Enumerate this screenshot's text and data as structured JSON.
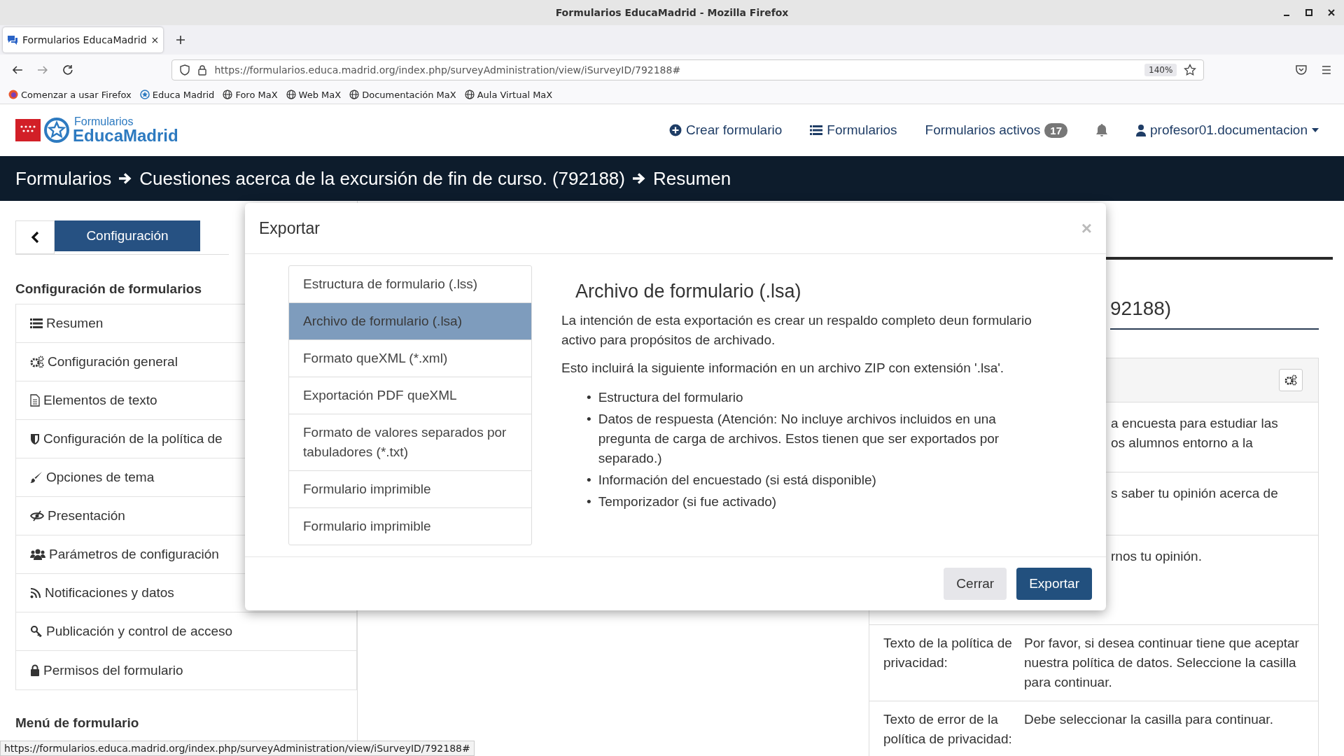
{
  "browser": {
    "window_title": "Formularios EducaMadrid - Mozilla Firefox",
    "tab": {
      "title": "Formularios EducaMadrid",
      "close": "×",
      "selected": true
    },
    "url": "https://formularios.educa.madrid.org/index.php/surveyAdministration/view/iSurveyID/792188#",
    "zoom": "140%",
    "bookmarks": [
      {
        "label": "Comenzar a usar Firefox",
        "kind": "firefox"
      },
      {
        "label": "Educa Madrid",
        "kind": "educa"
      },
      {
        "label": "Foro MaX",
        "kind": "globe"
      },
      {
        "label": "Web MaX",
        "kind": "globe"
      },
      {
        "label": "Documentación MaX",
        "kind": "globe"
      },
      {
        "label": "Aula Virtual MaX",
        "kind": "globe"
      }
    ]
  },
  "header": {
    "logo_top": "Formularios",
    "logo_bottom": "EducaMadrid",
    "nav": [
      {
        "label": "Crear formulario",
        "kind": "plus"
      },
      {
        "label": "Formularios",
        "kind": "list"
      },
      {
        "label": "Formularios activos",
        "badge": "17"
      }
    ],
    "user": "profesor01.documentacion"
  },
  "breadcrumb": [
    "Formularios",
    "Cuestiones acerca de la excursión de fin de curso. (792188)",
    "Resumen"
  ],
  "sidebar": {
    "tab": "Configuración",
    "heading": "Configuración de formularios",
    "items": [
      {
        "label": "Resumen",
        "kind": "list"
      },
      {
        "label": "Configuración general",
        "kind": "gears"
      },
      {
        "label": "Elementos de texto",
        "kind": "doc"
      },
      {
        "label": "Configuración de la política de",
        "kind": "shield"
      },
      {
        "label": "Opciones de tema",
        "kind": "brush"
      },
      {
        "label": "Presentación",
        "kind": "eye"
      },
      {
        "label": "Parámetros de configuración",
        "kind": "users"
      },
      {
        "label": "Notificaciones y datos",
        "kind": "rss"
      },
      {
        "label": "Publicación y control de acceso",
        "kind": "key"
      },
      {
        "label": "Permisos del formulario",
        "kind": "lock"
      }
    ],
    "footer_heading": "Menú de formulario"
  },
  "right_panel": {
    "title_fragment": "92188)",
    "rows": [
      {
        "kind": "fragment",
        "lines": [
          "a encuesta para estudiar las",
          "os alumnos entorno a la"
        ]
      },
      {
        "kind": "fragment",
        "lines": [
          "s saber tu opinión acerca de"
        ]
      },
      {
        "kind": "fragment",
        "lines": [
          "rnos tu opinión."
        ]
      },
      {
        "kind": "field",
        "label": "Texto de la política de privacidad:",
        "value": "Por favor, si desea continuar tiene que aceptar nuestra política de datos. Seleccione la casilla para continuar."
      },
      {
        "kind": "field",
        "label": "Texto de error de la política de privacidad:",
        "value": "Debe seleccionar la casilla para continuar."
      }
    ]
  },
  "modal": {
    "title": "Exportar",
    "close": "×",
    "options": [
      {
        "label": "Estructura de formulario (.lss)",
        "selected": false
      },
      {
        "label": "Archivo de formulario (.lsa)",
        "selected": true
      },
      {
        "label": "Formato queXML (*.xml)",
        "selected": false
      },
      {
        "label": "Exportación PDF queXML",
        "selected": false
      },
      {
        "label": "Formato de valores separados por tabuladores (*.txt)",
        "selected": false
      },
      {
        "label": "Formulario imprimible",
        "selected": false
      },
      {
        "label": "Formulario imprimible",
        "selected": false
      }
    ],
    "detail": {
      "heading": "Archivo de formulario (.lsa)",
      "paragraphs": [
        "La intención de esta exportación es crear un respaldo completo deun formulario activo para propósitos de archivado.",
        "Esto incluirá la siguiente información en un archivo ZIP con extensión '.lsa'."
      ],
      "bullet_marker": "•",
      "bullets": [
        "Estructura del formulario",
        "Datos de respuesta (Atención: No incluye archivos incluidos en una pregunta de carga de archivos. Estos tienen que ser exportados por separado.)",
        "Información del encuestado (si está disponible)",
        "Temporizador (si fue activado)"
      ]
    },
    "buttons": [
      {
        "label": "Cerrar",
        "kind": "secondary"
      },
      {
        "label": "Exportar",
        "kind": "primary"
      }
    ]
  },
  "status_url": "https://formularios.educa.madrid.org/index.php/surveyAdministration/view/iSurveyID/792188#"
}
